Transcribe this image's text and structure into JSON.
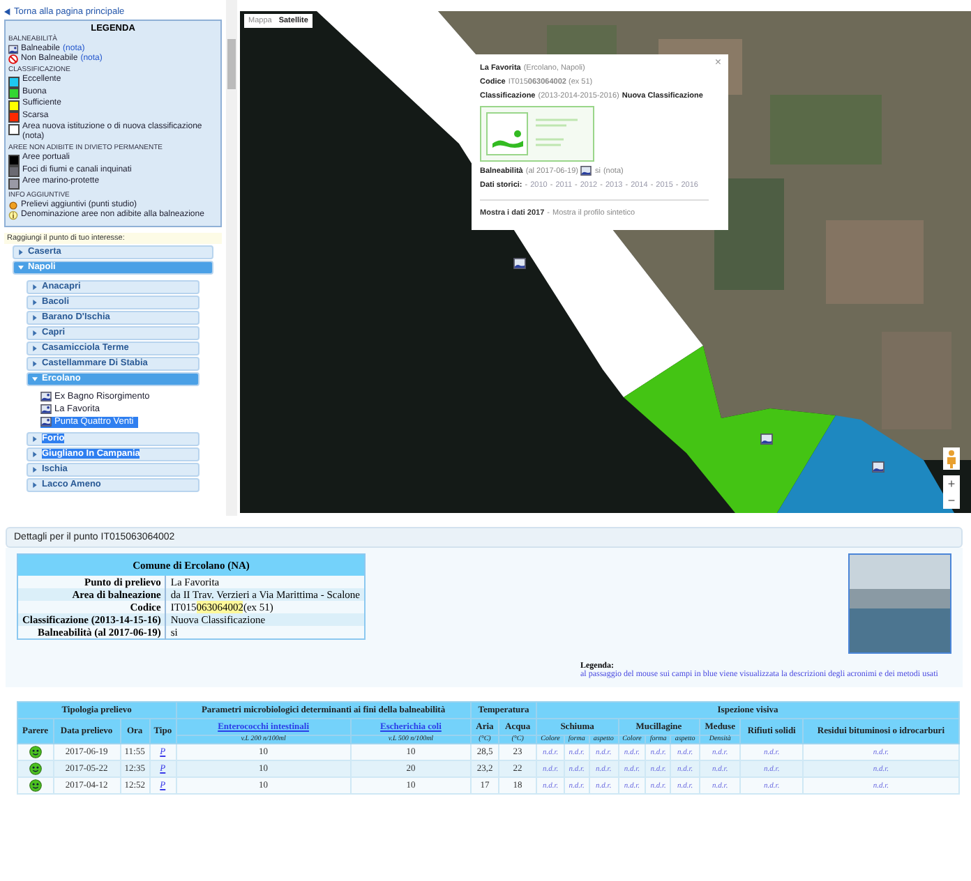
{
  "left_panel": {
    "back_link": "Torna alla pagina principale",
    "legend": {
      "title": "LEGENDA",
      "sections": [
        {
          "heading": "BALNEABILITÀ",
          "items": [
            {
              "kind": "bathing",
              "label": "Balneabile",
              "note": "(nota)"
            },
            {
              "kind": "no-bathing",
              "label": "Non Balneabile",
              "note": "(nota)"
            }
          ]
        },
        {
          "heading": "CLASSIFICAZIONE",
          "items": [
            {
              "kind": "swatch",
              "color": "#1ec8f2",
              "label": "Eccellente"
            },
            {
              "kind": "swatch",
              "color": "#33d633",
              "label": "Buona"
            },
            {
              "kind": "swatch",
              "color": "#ffff00",
              "label": "Sufficiente"
            },
            {
              "kind": "swatch",
              "color": "#ff2a00",
              "label": "Scarsa"
            },
            {
              "kind": "swatch",
              "color": "#ffffff",
              "label": "Area nuova istituzione o di nuova classificazione (nota)"
            }
          ]
        },
        {
          "heading": "AREE NON ADIBITE IN DIVIETO PERMANENTE",
          "items": [
            {
              "kind": "swatch",
              "color": "#000000",
              "label": "Aree portuali"
            },
            {
              "kind": "swatch",
              "color": "#6a6a72",
              "label": "Foci di fiumi e canali inquinati"
            },
            {
              "kind": "swatch",
              "color": "#9a9aa6",
              "label": "Aree marino-protette"
            }
          ]
        },
        {
          "heading": "INFO AGGIUNTIVE",
          "items": [
            {
              "kind": "extra-sample",
              "label": "Prelievi aggiuntivi (punti studio)"
            },
            {
              "kind": "info",
              "label": "Denominazione aree non adibite alla balneazione"
            }
          ]
        }
      ]
    },
    "search_label": "Raggiungi il punto di tuo interesse:",
    "tree": [
      {
        "label": "Caserta",
        "expanded": false
      },
      {
        "label": "Napoli",
        "expanded": true,
        "children": [
          {
            "label": "Anacapri",
            "expanded": false,
            "highlighted": false
          },
          {
            "label": "Bacoli",
            "expanded": false,
            "highlighted": false
          },
          {
            "label": "Barano D'Ischia",
            "expanded": false,
            "highlighted": false
          },
          {
            "label": "Capri",
            "expanded": false,
            "highlighted": false
          },
          {
            "label": "Casamicciola Terme",
            "expanded": false,
            "highlighted": false
          },
          {
            "label": "Castellammare Di Stabia",
            "expanded": false,
            "highlighted": false
          },
          {
            "label": "Ercolano",
            "expanded": true,
            "highlighted": false,
            "children": [
              {
                "label": "Ex Bagno Risorgimento",
                "selected": false
              },
              {
                "label": "La Favorita",
                "selected": false
              },
              {
                "label": "Punta Quattro Venti",
                "selected": true
              }
            ]
          },
          {
            "label": "Forio",
            "expanded": false,
            "highlighted": true
          },
          {
            "label": "Giugliano In Campania",
            "expanded": false,
            "highlighted": true
          },
          {
            "label": "Ischia",
            "expanded": false,
            "highlighted": false
          },
          {
            "label": "Lacco Ameno",
            "expanded": false,
            "highlighted": false
          }
        ]
      }
    ]
  },
  "map": {
    "map_types": [
      {
        "label": "Mappa",
        "selected": false
      },
      {
        "label": "Satellite",
        "selected": true
      }
    ],
    "zoom": [
      "+",
      "−"
    ],
    "popup": {
      "name": "La Favorita",
      "place": "(Ercolano, Napoli)",
      "close": "×",
      "code_label": "Codice",
      "code": "IT015**063064002** (ex 51)",
      "class_label": "Classificazione",
      "class_years": "(2013-2014-2015-2016)",
      "class_value": "Nuova Classificazione",
      "bathing_label": "Balneabilità",
      "bathing_date": "(al 2017-06-19)",
      "bathing_value": "si",
      "bathing_note": "(nota)",
      "history_label": "Dati storici:",
      "separator": "-",
      "history_years": [
        "2010",
        "2011",
        "2012",
        "2013",
        "2014",
        "2015",
        "2016"
      ],
      "links": [
        "Mostra i dati 2017",
        "Mostra il profilo sintetico"
      ]
    }
  },
  "details": {
    "title": "Dettagli per il punto IT015063064002",
    "info": {
      "header": "Comune di Ercolano (NA)",
      "rows": [
        {
          "label": "Punto di prelievo",
          "value": "La Favorita"
        },
        {
          "label": "Area di balneazione",
          "value": "da II Trav. Verzieri a Via Marittima - Scalone"
        },
        {
          "label": "Codice",
          "value": "IT015",
          "highlight": "063064002",
          "rest": "(ex 51)"
        },
        {
          "label": "Classificazione (2013-14-15-16)",
          "value": "Nuova Classificazione"
        },
        {
          "label": "Balneabilità (al 2017-06-19)",
          "value": "si"
        }
      ]
    },
    "legend_title": "Legenda:",
    "legend_text": "al passaggio del mouse sui campi in blue viene visualizzata la descrizioni degli acronimi e dei metodi usati"
  },
  "table": {
    "group_headers": [
      "Tipologia prelievo",
      "Parametri microbiologici determinanti ai fini della balneabilità",
      "Temperatura",
      "Ispezione visiva"
    ],
    "columns": [
      {
        "label": "Parere",
        "link": false
      },
      {
        "label": "Data prelievo",
        "link": false
      },
      {
        "label": "Ora",
        "link": false
      },
      {
        "label": "Tipo",
        "link": false
      },
      {
        "label": "Enterococchi intestinali",
        "unit": "v.L 200 n/100ml",
        "link": true
      },
      {
        "label": "Escherichia coli",
        "unit": "v.L 500 n/100ml",
        "link": true
      },
      {
        "label": "Aria",
        "unit": "(°C)",
        "link": false
      },
      {
        "label": "Acqua",
        "unit": "(°C)",
        "link": false
      }
    ],
    "inspection_groups": [
      {
        "label": "Schiuma",
        "subs": [
          "Colore",
          "forma",
          "aspetto"
        ]
      },
      {
        "label": "Mucillagine",
        "subs": [
          "Colore",
          "forma",
          "aspetto"
        ]
      },
      {
        "label": "Meduse",
        "subs": [
          "Densità"
        ]
      },
      {
        "label": "Rifiuti solidi"
      },
      {
        "label": "Residui bituminosi o idrocarburi"
      }
    ],
    "rows": [
      {
        "date": "2017-06-19",
        "time": "11:55",
        "type": "P",
        "enterococchi": "10",
        "ecoli": "10",
        "air": "28,5",
        "water": "23",
        "inspection": [
          "n.d.r.",
          "n.d.r.",
          "n.d.r.",
          "n.d.r.",
          "n.d.r.",
          "n.d.r.",
          "n.d.r.",
          "n.d.r.",
          "n.d.r."
        ]
      },
      {
        "date": "2017-05-22",
        "time": "12:35",
        "type": "P",
        "enterococchi": "10",
        "ecoli": "20",
        "air": "23,2",
        "water": "22",
        "inspection": [
          "n.d.r.",
          "n.d.r.",
          "n.d.r.",
          "n.d.r.",
          "n.d.r.",
          "n.d.r.",
          "n.d.r.",
          "n.d.r.",
          "n.d.r."
        ]
      },
      {
        "date": "2017-04-12",
        "time": "12:52",
        "type": "P",
        "enterococchi": "10",
        "ecoli": "10",
        "air": "17",
        "water": "18",
        "inspection": [
          "n.d.r.",
          "n.d.r.",
          "n.d.r.",
          "n.d.r.",
          "n.d.r.",
          "n.d.r.",
          "n.d.r.",
          "n.d.r.",
          "n.d.r."
        ]
      }
    ]
  }
}
